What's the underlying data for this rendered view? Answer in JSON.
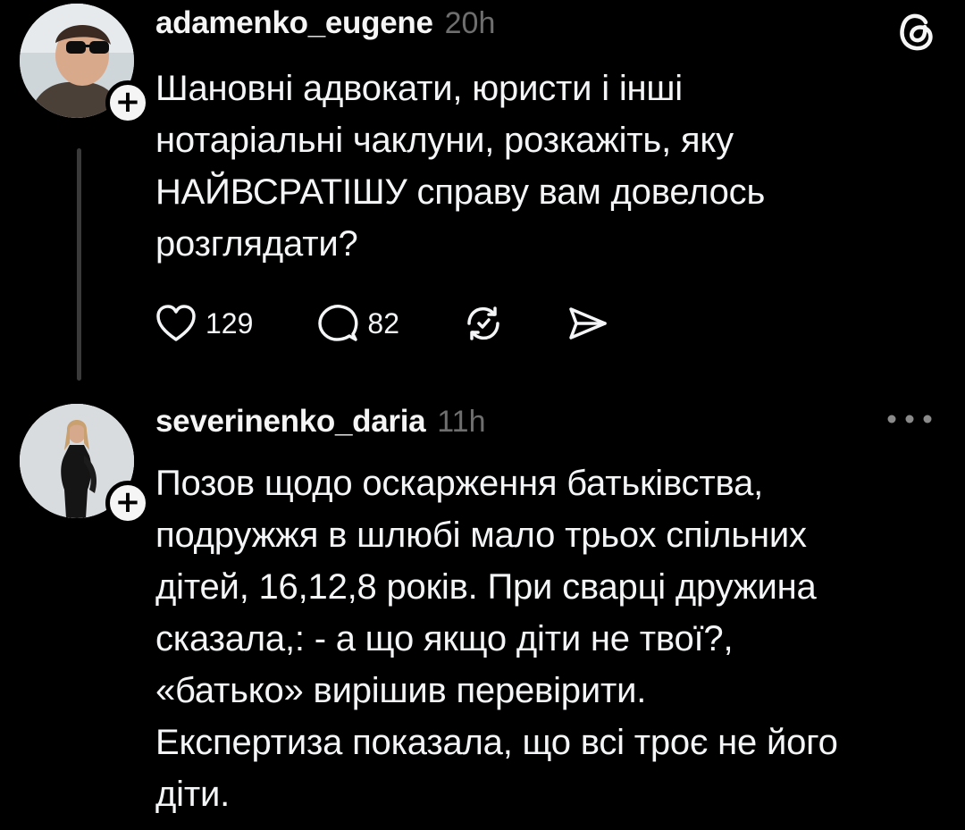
{
  "posts": [
    {
      "username": "adamenko_eugene",
      "time": "20h",
      "text": "Шановні адвокати, юристи і інші\nнотаріальні чаклуни, розкажіть, яку\nНАЙВСРАТІШУ справу вам довелось\nрозглядати?",
      "likes": "129",
      "replies": "82",
      "follow_glyph": "+",
      "icons": [
        "threads-logo-icon",
        "heart-icon",
        "comment-icon",
        "repost-icon",
        "share-icon"
      ]
    },
    {
      "username": "severinenko_daria",
      "time": "11h",
      "text": "Позов щодо оскарження батьківства,\nподружжя в шлюбі мало трьох спільних\nдітей, 16,12,8 років. При сварці дружина\nсказала,: - а що якщо діти не твої?,\n«батько» вирішив перевірити.\nЕкспертиза показала, що всі троє не його\nдіти.",
      "follow_glyph": "+",
      "icons": [
        "more-options-icon"
      ]
    }
  ],
  "colors": {
    "background": "#000000",
    "text": "#f3f5f7",
    "secondary": "#6e6e6e",
    "thread_line": "#3a3a3a"
  }
}
